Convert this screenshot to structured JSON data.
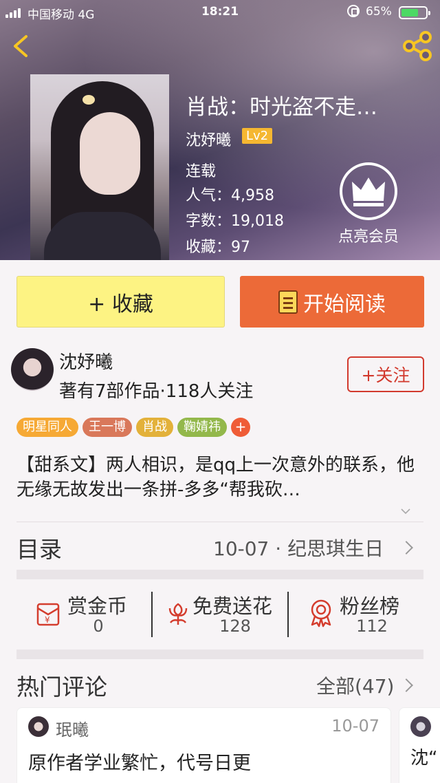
{
  "status_bar": {
    "carrier": "中国移动  4G",
    "time": "18:21",
    "battery": "65%"
  },
  "book": {
    "title": "肖战：时光盗不走…",
    "author": "沈妤曦",
    "level": "Lv2",
    "status": "连载",
    "popularity": "人气：4,958",
    "word_count": "字数：19,018",
    "favorites": "收藏：97",
    "vip_label": "点亮会员"
  },
  "actions": {
    "collect_label": "+ 收藏",
    "read_label": "开始阅读"
  },
  "author_row": {
    "name": "沈妤曦",
    "meta": "著有7部作品·118人关注",
    "follow_label": "+关注"
  },
  "tags": [
    {
      "label": "明星同人",
      "color": "#f6a935"
    },
    {
      "label": "王一博",
      "color": "#d9785a"
    },
    {
      "label": "肖战",
      "color": "#e3b13a"
    },
    {
      "label": "鞠婧祎",
      "color": "#93b84b"
    }
  ],
  "tag_add_label": "+",
  "synopsis": "【甜系文】两人相识，是qq上一次意外的联系，他无缘无故发出一条拼-多多“帮我砍…",
  "toc": {
    "title": "目录",
    "latest": "10-07 · 纪思琪生日"
  },
  "rewards": [
    {
      "label": "赏金币",
      "value": "0",
      "icon": "red-envelope-icon"
    },
    {
      "label": "免费送花",
      "value": "128",
      "icon": "flower-icon"
    },
    {
      "label": "粉丝榜",
      "value": "112",
      "icon": "medal-icon"
    }
  ],
  "comments": {
    "title": "热门评论",
    "all_label": "全部(47)",
    "items": [
      {
        "user": "珉曦",
        "date": "10-07",
        "text": "原作者学业繁忙，代号日更"
      },
      {
        "user": "",
        "date": "",
        "text": "沈“"
      }
    ]
  },
  "colors": {
    "collect_bg": "#fdf383",
    "read_bg": "#ec6a38",
    "follow": "#d2392d",
    "level_badge": "#f5b731"
  }
}
